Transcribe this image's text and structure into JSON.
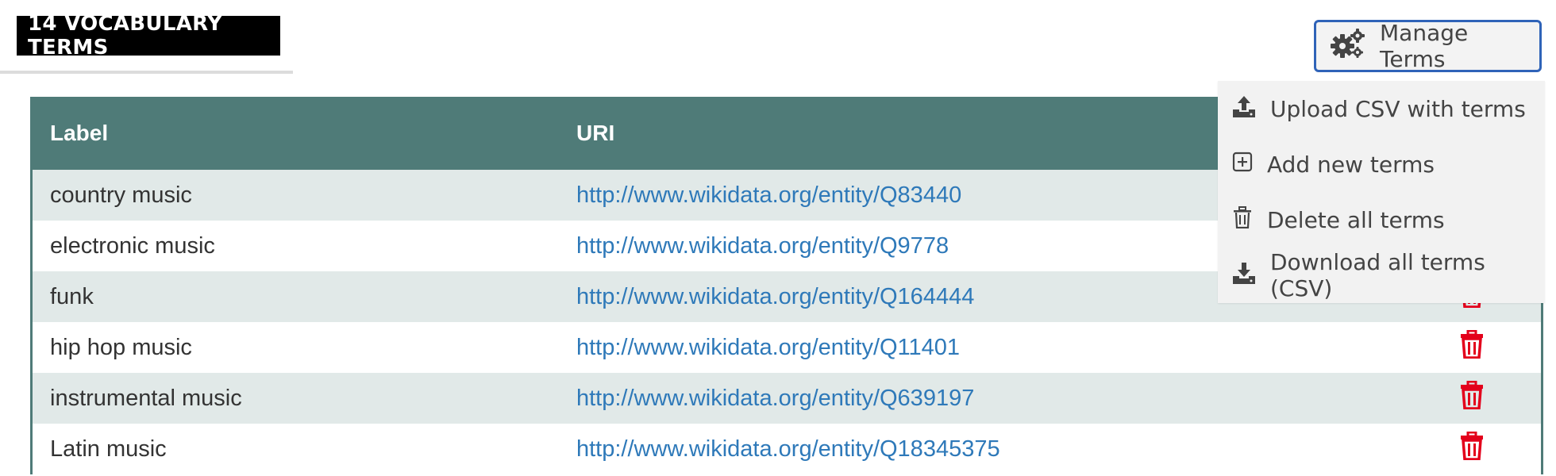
{
  "header": {
    "title": "14 VOCABULARY TERMS",
    "manage_label": "Manage Terms"
  },
  "table": {
    "columns": [
      "Label",
      "URI",
      ""
    ],
    "rows": [
      {
        "label": "country music",
        "uri": "http://www.wikidata.org/entity/Q83440"
      },
      {
        "label": "electronic music",
        "uri": "http://www.wikidata.org/entity/Q9778"
      },
      {
        "label": "funk",
        "uri": "http://www.wikidata.org/entity/Q164444"
      },
      {
        "label": "hip hop music",
        "uri": "http://www.wikidata.org/entity/Q11401"
      },
      {
        "label": "instrumental music",
        "uri": "http://www.wikidata.org/entity/Q639197"
      },
      {
        "label": "Latin music",
        "uri": "http://www.wikidata.org/entity/Q18345375"
      }
    ]
  },
  "menu": {
    "items": [
      {
        "label": "Upload CSV with terms",
        "icon": "upload-icon"
      },
      {
        "label": "Add new terms",
        "icon": "plus-square-icon"
      },
      {
        "label": "Delete all terms",
        "icon": "trash-icon"
      },
      {
        "label": "Download all terms (CSV)",
        "icon": "download-icon"
      }
    ]
  },
  "colors": {
    "header_bg": "#4f7b78",
    "row_alt": "#e1e9e8",
    "link": "#2e79b9",
    "delete": "#e3001b",
    "focus_border": "#2f63b8"
  }
}
